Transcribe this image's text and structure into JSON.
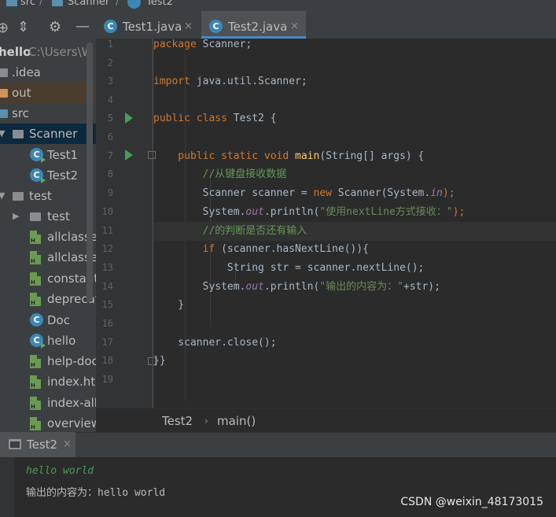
{
  "breadcrumb": {
    "src": "src",
    "scanner": "Scanner",
    "test2": "Test2",
    "sep": "/"
  },
  "project_tree": {
    "root_label": "hello",
    "root_path": "C:\\Users\\W",
    "items": [
      {
        "label": ".idea"
      },
      {
        "label": "out"
      },
      {
        "label": "src"
      },
      {
        "label": "Scanner"
      },
      {
        "label": "Test1"
      },
      {
        "label": "Test2"
      },
      {
        "label": "test"
      },
      {
        "label": "test"
      },
      {
        "label": "allclasses"
      },
      {
        "label": "allclasses"
      },
      {
        "label": "constant"
      },
      {
        "label": "deprecat"
      },
      {
        "label": "Doc"
      },
      {
        "label": "hello"
      },
      {
        "label": "help-doc"
      },
      {
        "label": "index.htm"
      },
      {
        "label": "index-all"
      },
      {
        "label": "overview"
      }
    ]
  },
  "tabs": [
    {
      "label": "Test1.java",
      "active": false
    },
    {
      "label": "Test2.java",
      "active": true
    }
  ],
  "tab_close": "×",
  "line_numbers": [
    "1",
    "2",
    "3",
    "4",
    "5",
    "6",
    "7",
    "8",
    "9",
    "10",
    "11",
    "12",
    "13",
    "14",
    "15",
    "16",
    "17",
    "18",
    "19"
  ],
  "code": {
    "l1a": "package",
    "l1b": " Scanner;",
    "l3a": "import",
    "l3b": " java.util.Scanner;",
    "l5a": "public class",
    "l5b": " Test2 {",
    "l7a": "    public static void ",
    "l7b": "main",
    "l7c": "(String[] args) {",
    "l8": "        //从键盘接收数据",
    "l9a": "        Scanner scanner = ",
    "l9b": "new",
    "l9c": " Scanner(System.",
    "l9d": "in",
    "l9e": ");",
    "l10a": "        System.",
    "l10b": "out",
    "l10c": ".println(",
    "l10d": "\"使用nextLine方式接收：\"",
    "l10e": ");",
    "l11": "        //的判断是否还有输入",
    "l12a": "        ",
    "l12b": "if",
    "l12c": " (scanner.hasNextLine()){",
    "l13": "            String str = scanner.nextLine();",
    "l14a": "        System.",
    "l14b": "out",
    "l14c": ".println(",
    "l14d": "\"输出的内容为：\"",
    "l14e": "+str);",
    "l15": "    }",
    "l17": "    scanner.close();",
    "l18": "}}"
  },
  "editor_breadcrumb": {
    "class": "Test2",
    "sep": "›",
    "method": "main()"
  },
  "run_panel": {
    "tab_label": "Test2",
    "close": "×"
  },
  "console": {
    "input_line": "hello world",
    "output_line": "输出的内容为：hello world"
  },
  "watermark": "CSDN @weixin_48173015",
  "colors": {
    "keyword": "#cc7832",
    "comment": "#629755",
    "string": "#6a8759",
    "method": "#ffc66d",
    "static_field": "#9876aa",
    "selection": "#0d293e",
    "user_input": "#499c54"
  },
  "icons": [
    "target-icon",
    "collapse-icon",
    "gear-icon",
    "minimize-icon",
    "folder-icon",
    "java-class-icon",
    "html-file-icon",
    "run-gutter-icon",
    "fold-icon",
    "console-icon"
  ]
}
